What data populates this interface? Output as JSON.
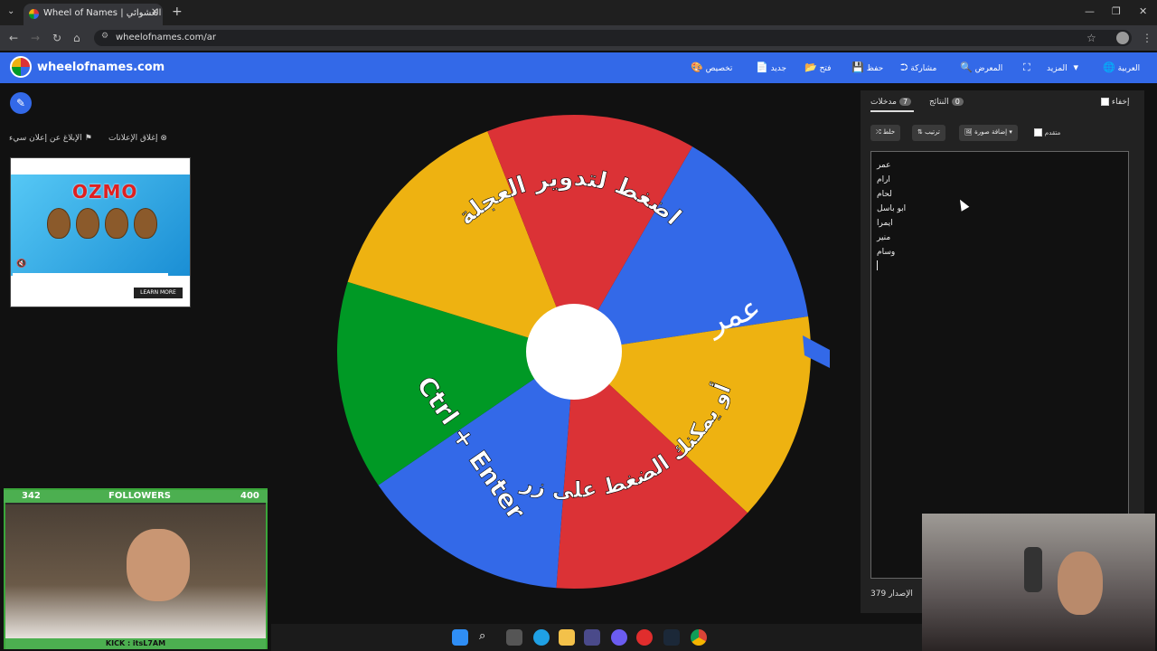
{
  "browser": {
    "tab_title": "Wheel of Names | اسم العشوائي",
    "url": "wheelofnames.com/ar"
  },
  "site": {
    "name": "wheelofnames.com",
    "menu": {
      "language": "العربية",
      "more": "المزيد",
      "gallery": "المعرض",
      "share": "مشاركة",
      "save": "حفظ",
      "open": "فتح",
      "new": "جديد",
      "customize": "تخصيص"
    }
  },
  "ads": {
    "close_ads": "إغلاق الإعلانات",
    "report_ad": "الإبلاغ عن إعلان سيء",
    "brand": "OZMO",
    "learn_more": "LEARN MORE"
  },
  "right_panel": {
    "hide_label": "إخفاء",
    "tabs": [
      {
        "label": "مدخلات",
        "count": "7"
      },
      {
        "label": "النتائج",
        "count": "0"
      }
    ],
    "shuffle": "خلط",
    "sort": "ترتيب",
    "add_image": "إضافة صورة",
    "advanced": "متقدم",
    "entries": [
      "عمر",
      "ارام",
      "لحام",
      "ابو باسل",
      "ايمرا",
      "منير",
      "وسام"
    ],
    "version_label": "الإصدار",
    "version": "379"
  },
  "wheel": {
    "instruction_top": "اضغط لتدوير العجلة",
    "instruction_bottom": "أو يمكنك الضغط على زر",
    "shortcut": "Ctrl + Enter",
    "visible_name": "عمر",
    "colors": {
      "red": "#db3236",
      "blue": "#3369e8",
      "yellow": "#eeb211",
      "green": "#009925"
    }
  },
  "stream": {
    "followers_label": "FOLLOWERS",
    "followers_current": "342",
    "followers_goal": "400",
    "channel": "KICK : itsL7AM"
  }
}
